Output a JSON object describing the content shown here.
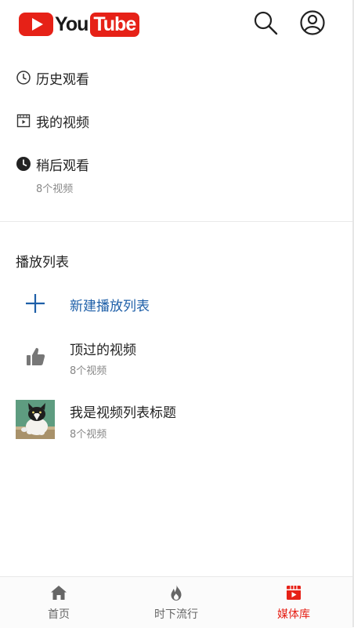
{
  "header": {
    "logo_you": "You",
    "logo_tube": "Tube",
    "search_icon": "search-icon",
    "account_icon": "account-icon"
  },
  "menu": {
    "history": {
      "label": "历史观看",
      "icon": "clock-outline-icon"
    },
    "my_videos": {
      "label": "我的视频",
      "icon": "video-file-icon"
    },
    "watch_later": {
      "label": "稍后观看",
      "icon": "clock-filled-icon",
      "count": "8个视频"
    }
  },
  "playlists": {
    "section_title": "播放列表",
    "new_playlist": {
      "label": "新建播放列表",
      "icon": "plus-icon"
    },
    "items": [
      {
        "title": "顶过的视频",
        "count": "8个视频",
        "icon": "thumb-up-icon"
      },
      {
        "title": "我是视频列表标题",
        "count": "8个视频",
        "icon": "cat-thumbnail"
      }
    ]
  },
  "bottom_nav": {
    "items": [
      {
        "label": "首页",
        "icon": "home-icon",
        "active": false
      },
      {
        "label": "时下流行",
        "icon": "fire-icon",
        "active": false
      },
      {
        "label": "媒体库",
        "icon": "library-icon",
        "active": true
      }
    ]
  },
  "colors": {
    "brand_red": "#e62117",
    "link_blue": "#1e5fa8",
    "muted_text": "#888888",
    "nav_inactive": "#666666"
  }
}
